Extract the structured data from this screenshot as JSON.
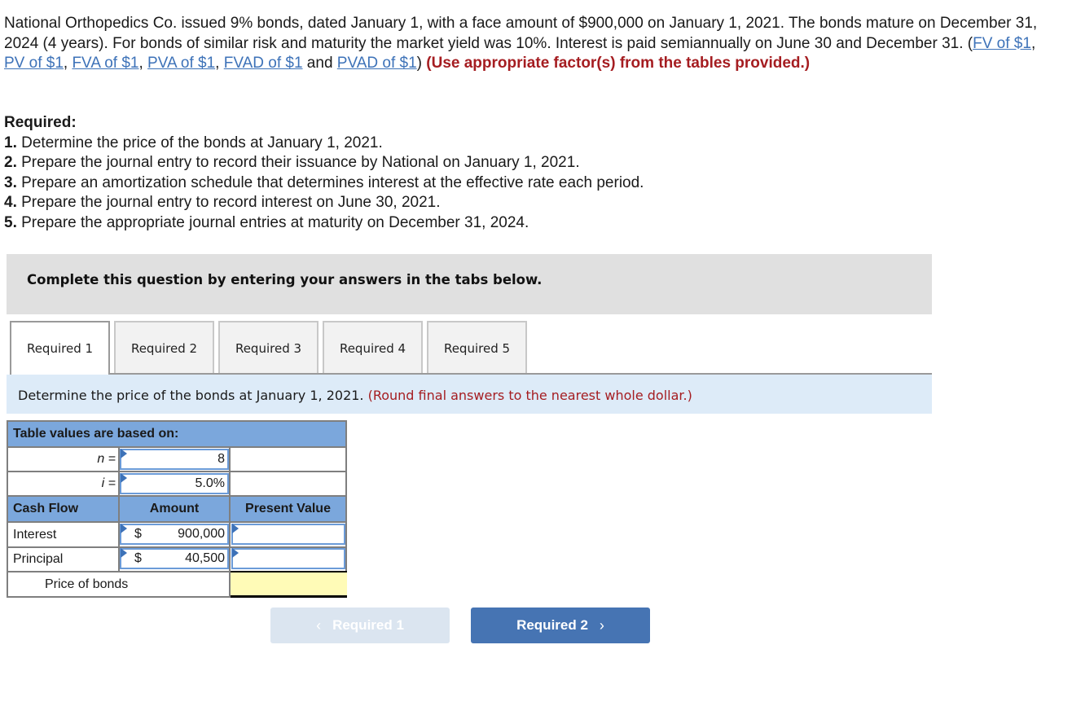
{
  "problem": {
    "text_before_links": "National Orthopedics Co. issued 9% bonds, dated January 1, with a face amount of $900,000 on January 1, 2021. The bonds mature on December 31, 2024 (4 years). For bonds of similar risk and maturity the market yield was 10%. Interest is paid semiannually on June 30 and December 31. (",
    "links": [
      {
        "label": "FV of $1"
      },
      {
        "label": "PV of $1"
      },
      {
        "label": "FVA of $1"
      },
      {
        "label": "PVA of $1"
      },
      {
        "label": "FVAD of $1"
      },
      {
        "label": "PVAD of $1"
      }
    ],
    "sep_comma": ", ",
    "sep_and": " and ",
    "close_paren": ") ",
    "emphasis": "(Use appropriate factor(s) from the tables provided.)"
  },
  "required": {
    "title": "Required:",
    "items": [
      {
        "num": "1.",
        "text": " Determine the price of the bonds at January 1, 2021."
      },
      {
        "num": "2.",
        "text": " Prepare the journal entry to record their issuance by National on January 1, 2021."
      },
      {
        "num": "3.",
        "text": " Prepare an amortization schedule that determines interest at the effective rate each period."
      },
      {
        "num": "4.",
        "text": " Prepare the journal entry to record interest on June 30, 2021."
      },
      {
        "num": "5.",
        "text": " Prepare the appropriate journal entries at maturity on December 31, 2024."
      }
    ]
  },
  "instruction": "Complete this question by entering your answers in the tabs below.",
  "tabs": [
    {
      "label": "Required 1",
      "active": true
    },
    {
      "label": "Required 2",
      "active": false
    },
    {
      "label": "Required 3",
      "active": false
    },
    {
      "label": "Required 4",
      "active": false
    },
    {
      "label": "Required 5",
      "active": false
    }
  ],
  "prompt": {
    "text": "Determine the price of the bonds at January 1, 2021. ",
    "note": "(Round final answers to the nearest whole dollar.)"
  },
  "table": {
    "header": "Table values are based on:",
    "n_label": "n =",
    "n_value": "8",
    "i_label": "i =",
    "i_value": "5.0%",
    "columns": [
      "Cash Flow",
      "Amount",
      "Present Value"
    ],
    "rows": [
      {
        "label": "Interest",
        "currency": "$",
        "amount": "900,000",
        "present_value": ""
      },
      {
        "label": "Principal",
        "currency": "$",
        "amount": "40,500",
        "present_value": ""
      }
    ],
    "total_label": "Price of bonds",
    "total_value": ""
  },
  "navigation": {
    "prev_label": "Required 1",
    "next_label": "Required 2",
    "prev_icon": "‹",
    "next_icon": "›"
  },
  "colors": {
    "link": "#3d72b8",
    "emphasis": "#a51d21",
    "table_header": "#7ba7dc",
    "total_highlight": "#fffbb7",
    "next_button": "#4674b3"
  }
}
